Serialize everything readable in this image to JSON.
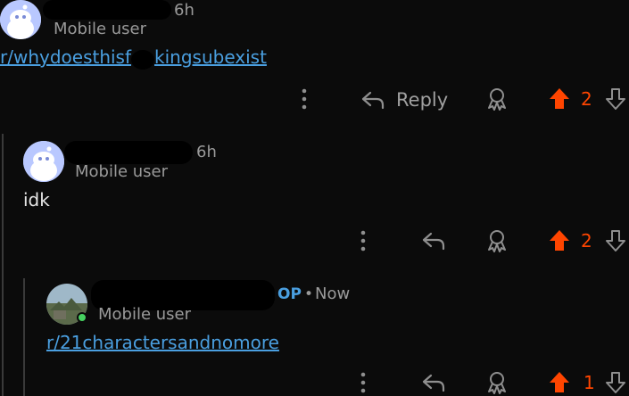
{
  "comments": [
    {
      "time": "6h",
      "flair": "Mobile user",
      "link": "r/whydoesthisf",
      "link_tail": "kingsubexist",
      "actions": {
        "reply_label": "Reply",
        "score": "2"
      }
    },
    {
      "time": "6h",
      "flair": "Mobile user",
      "body": "idk",
      "actions": {
        "score": "2"
      }
    },
    {
      "op_badge": "OP",
      "separator": "•",
      "time": "Now",
      "flair": "Mobile user",
      "link": "r/21charactersandnomore",
      "actions": {
        "score": "1"
      }
    }
  ],
  "icons": {
    "more": "more-vertical-icon",
    "reply": "reply-arrow-icon",
    "award": "award-icon",
    "upvote": "upvote-icon",
    "downvote": "downvote-icon"
  },
  "colors": {
    "background": "#0b0b0b",
    "upvote": "#ff4500",
    "link": "#4a9fe0",
    "online": "#46d160"
  }
}
